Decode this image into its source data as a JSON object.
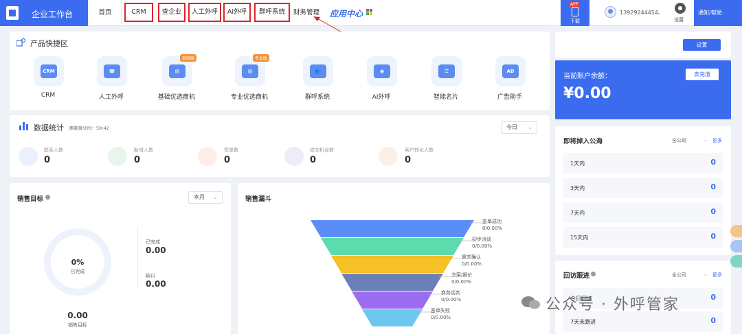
{
  "topbar": {
    "brand": "企业工作台",
    "nav": [
      "首页",
      "CRM",
      "查企业",
      "人工外呼",
      "AI外呼",
      "群呼系统",
      "财务管理"
    ],
    "app_center": "应用中心",
    "download_badge": "APP",
    "download_label": "下载",
    "username": "13929244454",
    "settings_label": "设置",
    "notify_label": "通知/帮助"
  },
  "quick": {
    "title": "产品快捷区",
    "items": [
      {
        "label": "CRM",
        "icon": "CRM",
        "tag": ""
      },
      {
        "label": "人工外呼",
        "icon": "☎",
        "tag": ""
      },
      {
        "label": "基础优选商机",
        "icon": "▤",
        "tag": "基础版"
      },
      {
        "label": "专业优选商机",
        "icon": "▤",
        "tag": "专业版"
      },
      {
        "label": "群呼系统",
        "icon": "👥",
        "tag": ""
      },
      {
        "label": "AI外呼",
        "icon": "◉",
        "tag": ""
      },
      {
        "label": "智能名片",
        "icon": "☰",
        "tag": ""
      },
      {
        "label": "广告助手",
        "icon": "AD",
        "tag": ""
      }
    ]
  },
  "stats": {
    "title": "数据统计",
    "refresh": "刷新倒计时：59:42",
    "period": "今日",
    "items": [
      {
        "label": "联系人数",
        "value": "0"
      },
      {
        "label": "新增人数",
        "value": "0"
      },
      {
        "label": "签单数",
        "value": "0"
      },
      {
        "label": "成交机会数",
        "value": "0"
      },
      {
        "label": "客户转化人数",
        "value": "0"
      }
    ]
  },
  "sales_target": {
    "title": "销售目标",
    "period": "本月",
    "percent": "0%",
    "percent_label": "已完成",
    "completed_label": "已完成",
    "completed_value": "0.00",
    "gap_label": "缺口",
    "gap_value": "0.00",
    "target_value": "0.00",
    "target_label": "销售目标"
  },
  "funnel": {
    "title": "销售漏斗",
    "stages": [
      {
        "name": "签单成功",
        "value": "0/0.00%",
        "color": "#5b8df7"
      },
      {
        "name": "初步洽谈",
        "value": "0/0.00%",
        "color": "#5ddbaf"
      },
      {
        "name": "需求确认",
        "value": "0/0.00%",
        "color": "#f6c026"
      },
      {
        "name": "方案/报价",
        "value": "0/0.00%",
        "color": "#6c7fb8"
      },
      {
        "name": "商务谈判",
        "value": "0/0.00%",
        "color": "#9b6cf0"
      },
      {
        "name": "签单失败",
        "value": "0/0.00%",
        "color": "#6cc7ee"
      }
    ]
  },
  "right": {
    "settings_button": "设置",
    "balance_label": "当前账户余额：",
    "balance_value": "¥0.00",
    "recharge_button": "去充值",
    "pool": {
      "title": "即将掉入公海",
      "scope": "全公司",
      "more": "更多",
      "rows": [
        {
          "label": "1天内",
          "value": "0"
        },
        {
          "label": "3天内",
          "value": "0"
        },
        {
          "label": "7天内",
          "value": "0"
        },
        {
          "label": "15天内",
          "value": "0"
        }
      ]
    },
    "followup": {
      "title": "回访跟进",
      "scope": "全公司",
      "more": "更多",
      "rows": [
        {
          "label": "今日回访",
          "value": "0"
        },
        {
          "label": "7天未跟进",
          "value": "0"
        }
      ]
    }
  },
  "watermark": "公众号 · 外呼管家"
}
